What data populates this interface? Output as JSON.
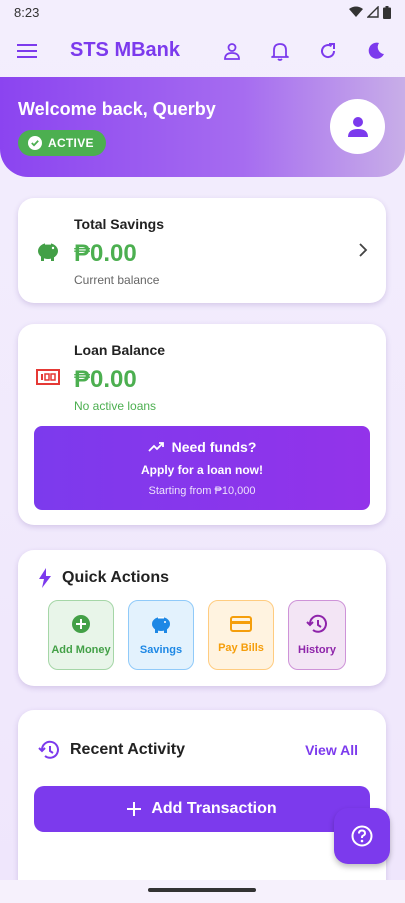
{
  "status_bar": {
    "time": "8:23"
  },
  "app_bar": {
    "title": "STS MBank"
  },
  "welcome": {
    "title": "Welcome back, Querby",
    "status": "ACTIVE"
  },
  "savings": {
    "label": "Total Savings",
    "amount": "₱0.00",
    "sub": "Current balance"
  },
  "loan": {
    "label": "Loan Balance",
    "amount": "₱0.00",
    "sub": "No active loans",
    "cta_title": "Need funds?",
    "cta_sub": "Apply for a loan now!",
    "cta_note": "Starting from ₱10,000"
  },
  "quick_actions": {
    "title": "Quick Actions",
    "items": [
      {
        "label": "Add Money",
        "icon": "add-circle-icon"
      },
      {
        "label": "Savings",
        "icon": "piggy-bank-icon"
      },
      {
        "label": "Pay Bills",
        "icon": "credit-card-icon"
      },
      {
        "label": "History",
        "icon": "history-icon"
      }
    ]
  },
  "recent_activity": {
    "title": "Recent Activity",
    "view_all": "View All",
    "add_transaction": "Add Transaction"
  },
  "colors": {
    "primary": "#7c3aed",
    "success": "#4caf50",
    "danger": "#e53935"
  }
}
